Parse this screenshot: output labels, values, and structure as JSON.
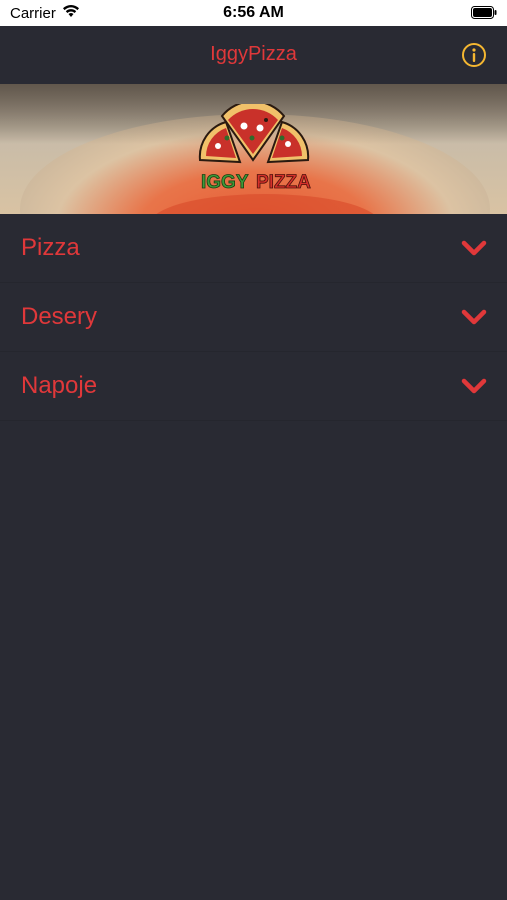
{
  "status_bar": {
    "carrier": "Carrier",
    "time": "6:56 AM"
  },
  "nav": {
    "title": "IggyPizza",
    "info_icon": "info-circle-icon"
  },
  "banner": {
    "logo_text": "IGGY PIZZA"
  },
  "menu": {
    "items": [
      {
        "label": "Pizza",
        "icon": "chevron-down-icon"
      },
      {
        "label": "Desery",
        "icon": "chevron-down-icon"
      },
      {
        "label": "Napoje",
        "icon": "chevron-down-icon"
      }
    ]
  },
  "colors": {
    "background": "#292a33",
    "accent_red": "#e0383a",
    "info_yellow": "#f5b731"
  }
}
